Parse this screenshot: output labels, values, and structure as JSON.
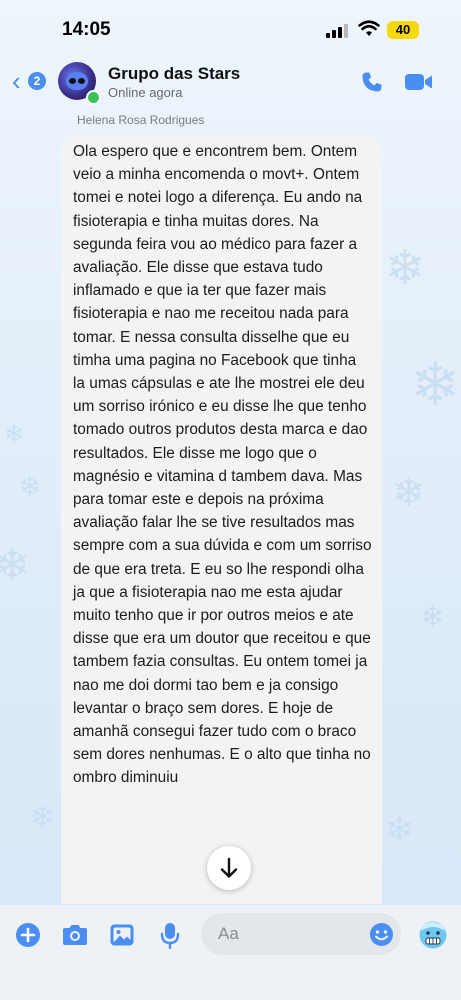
{
  "status_bar": {
    "time": "14:05",
    "battery": "40"
  },
  "header": {
    "back_badge": "2",
    "chat_title": "Grupo das Stars",
    "presence": "Online agora",
    "icons": [
      "back-chevron-icon",
      "phone-icon",
      "video-camera-icon"
    ]
  },
  "message": {
    "sender": "Helena Rosa Rodrigues",
    "text": "Ola espero que e encontrem bem. Ontem veio a minha encomenda o movt+. Ontem tomei e notei logo a diferença. Eu ando na fisioterapia e tinha muitas dores. Na segunda feira vou ao médico para fazer a avaliação. Ele disse que estava tudo inflamado e que ia ter que fazer mais fisioterapia e nao me receitou nada para tomar. E nessa consulta disselhe que eu timha uma pagina no Facebook que tinha la umas cápsulas e ate lhe mostrei ele deu um sorriso irónico e eu disse lhe que tenho tomado outros produtos desta marca e dao resultados. Ele disse me logo que o magnésio e vitamina d tambem dava. Mas para tomar este e depois na próxima avaliação falar lhe se tive resultados mas sempre com a sua dúvida e com um sorriso de que era treta. E eu so lhe respondi olha ja que a fisioterapia nao me esta ajudar muito tenho que ir por outros meios e ate disse que era um doutor que receitou e que tambem fazia consultas. Eu ontem tomei ja nao me doi dormi tao bem e ja consigo levantar o braço sem dores. E hoje de amanhã consegui fazer tudo com o braco sem dores nenhumas. E o alto que tinha no ombro diminuiu"
  },
  "composer": {
    "placeholder": "Aa",
    "icons": [
      "plus-icon",
      "camera-icon",
      "gallery-icon",
      "microphone-icon",
      "emoji-icon",
      "freezing-face-emoji-icon"
    ]
  },
  "colors": {
    "accent": "#4a8ef2",
    "online": "#3cc25a",
    "battery": "#f5d90a",
    "bubble": "#f2f3f5"
  }
}
